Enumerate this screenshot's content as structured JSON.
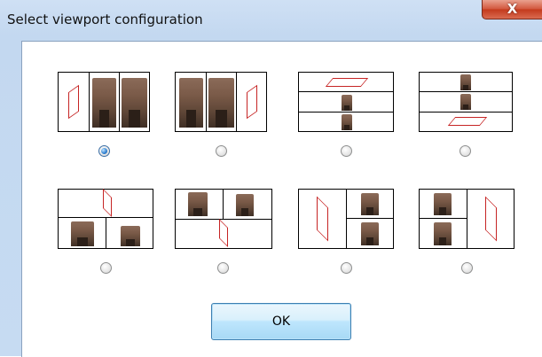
{
  "window": {
    "title": "Select viewport configuration",
    "close_glyph": "X"
  },
  "layouts": [
    {
      "id": "three-columns-left",
      "selected": true
    },
    {
      "id": "three-columns-right",
      "selected": false
    },
    {
      "id": "three-rows-top",
      "selected": false
    },
    {
      "id": "three-rows-bottom",
      "selected": false
    },
    {
      "id": "top-wide-bottom-split",
      "selected": false
    },
    {
      "id": "top-split-bottom-wide",
      "selected": false
    },
    {
      "id": "left-tall-right-split",
      "selected": false
    },
    {
      "id": "left-split-right-tall",
      "selected": false
    }
  ],
  "ok_button": {
    "label": "OK"
  },
  "icons": {
    "close": "close-icon",
    "building": "building-thumbnail-icon",
    "plane": "parallelogram-plane-icon"
  },
  "colors": {
    "plane_outline": "#c62424",
    "selection_blue": "#2f7fd0"
  }
}
